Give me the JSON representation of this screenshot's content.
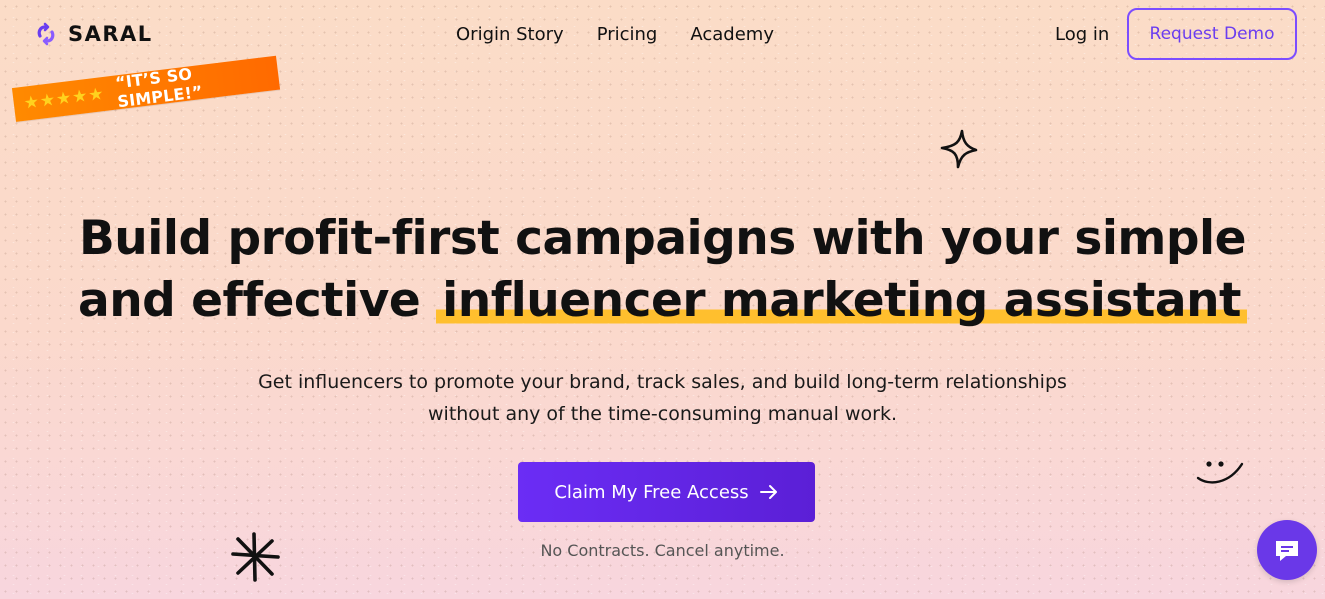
{
  "nav": {
    "logo_text": "SARAL",
    "links": [
      "Origin Story",
      "Pricing",
      "Academy"
    ],
    "login_label": "Log in",
    "demo_label": "Request Demo"
  },
  "badge": {
    "stars": "★★★★★",
    "text": "“IT’S SO SIMPLE!”"
  },
  "hero": {
    "headline_line1": "Build profit-first campaigns with your simple",
    "headline_line2_pre": "and effective",
    "headline_line2_highlight": "influencer marketing assistant",
    "subtitle_line1": "Get influencers to promote your brand, track sales, and build long-term relationships",
    "subtitle_line2": "without any of the time-consuming manual work.",
    "cta_label": "Claim My Free Access",
    "note": "No Contracts. Cancel anytime."
  },
  "icons": {
    "logo": "saral-logo-icon",
    "cta_arrow": "arrow-right-icon",
    "chat": "chat-bubble-icon"
  },
  "colors": {
    "accent": "#6b2df5",
    "highlight": "#ffbf2e",
    "badge": "#ff7a00",
    "demo_border": "#7c4dff"
  }
}
